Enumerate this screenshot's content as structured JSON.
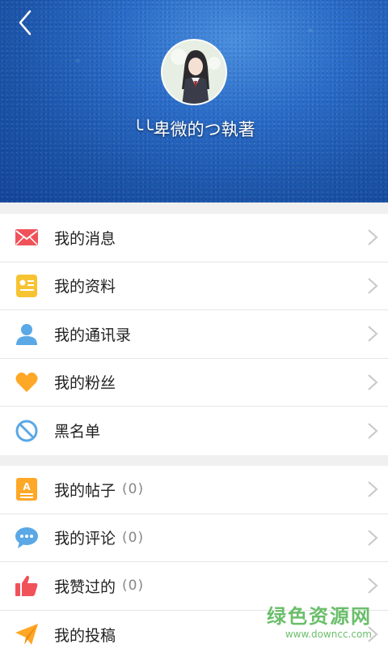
{
  "header": {
    "username": "╰╰卑微的つ執著"
  },
  "menu_group_1": [
    {
      "label": "我的消息",
      "icon": "mail-icon",
      "color": "#f0525a"
    },
    {
      "label": "我的资料",
      "icon": "profile-card-icon",
      "color": "#f7c331"
    },
    {
      "label": "我的通讯录",
      "icon": "contact-person-icon",
      "color": "#5aa8e6"
    },
    {
      "label": "我的粉丝",
      "icon": "heart-icon",
      "color": "#ffa726"
    },
    {
      "label": "黑名单",
      "icon": "blocked-icon",
      "color": "#5aa8e6"
    }
  ],
  "menu_group_2": [
    {
      "label": "我的帖子",
      "count": "(0)",
      "icon": "post-document-icon",
      "color": "#ffa726"
    },
    {
      "label": "我的评论",
      "count": "(0)",
      "icon": "comment-bubble-icon",
      "color": "#5aa8e6"
    },
    {
      "label": "我赞过的",
      "count": "(0)",
      "icon": "thumbs-up-icon",
      "color": "#f0525a"
    },
    {
      "label": "我的投稿",
      "icon": "paper-plane-icon",
      "color": "#ffa726"
    }
  ],
  "watermark": {
    "text": "绿色资源网",
    "url": "www.downcc.com"
  }
}
